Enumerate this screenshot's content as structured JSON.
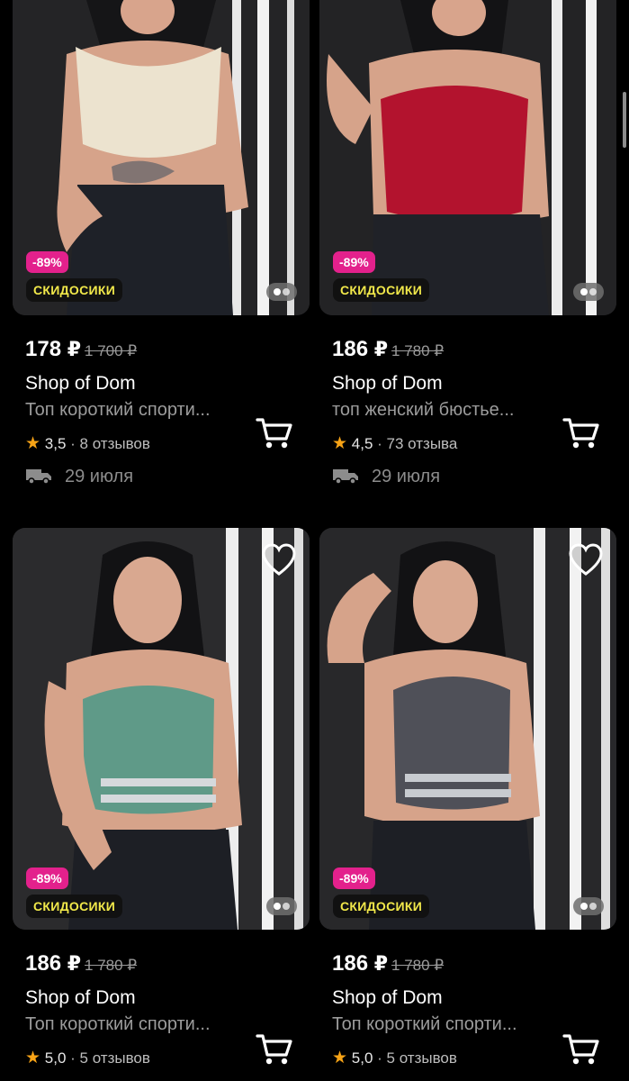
{
  "products": [
    {
      "discount": "-89%",
      "promo": "СКИДОСИКИ",
      "price": "178",
      "currency": "₽",
      "old_price": "1 700 ₽",
      "seller": "Shop of Dom",
      "title": "Топ короткий спорти...",
      "rating": "3,5",
      "reviews": "8 отзывов",
      "delivery": "29 июля",
      "garment_color": "#ece3cf"
    },
    {
      "discount": "-89%",
      "promo": "СКИДОСИКИ",
      "price": "186",
      "currency": "₽",
      "old_price": "1 780 ₽",
      "seller": "Shop of Dom",
      "title": "топ женский бюстье...",
      "rating": "4,5",
      "reviews": "73 отзыва",
      "delivery": "29 июля",
      "garment_color": "#b3132e"
    },
    {
      "discount": "-89%",
      "promo": "СКИДОСИКИ",
      "price": "186",
      "currency": "₽",
      "old_price": "1 780 ₽",
      "seller": "Shop of Dom",
      "title": "Топ короткий спорти...",
      "rating": "5,0",
      "reviews": "5 отзывов",
      "garment_color": "#5f9a88"
    },
    {
      "discount": "-89%",
      "promo": "СКИДОСИКИ",
      "price": "186",
      "currency": "₽",
      "old_price": "1 780 ₽",
      "seller": "Shop of Dom",
      "title": "Топ короткий спорти...",
      "rating": "5,0",
      "reviews": "5 отзывов",
      "garment_color": "#4f5058"
    }
  ],
  "colors": {
    "discount_badge": "#e3218c",
    "promo_text": "#f1e84a",
    "star": "#f7a316",
    "background": "#000000"
  },
  "icons": [
    "heart-icon",
    "cart-icon",
    "truck-icon",
    "star-icon",
    "gallery-dots-icon"
  ]
}
